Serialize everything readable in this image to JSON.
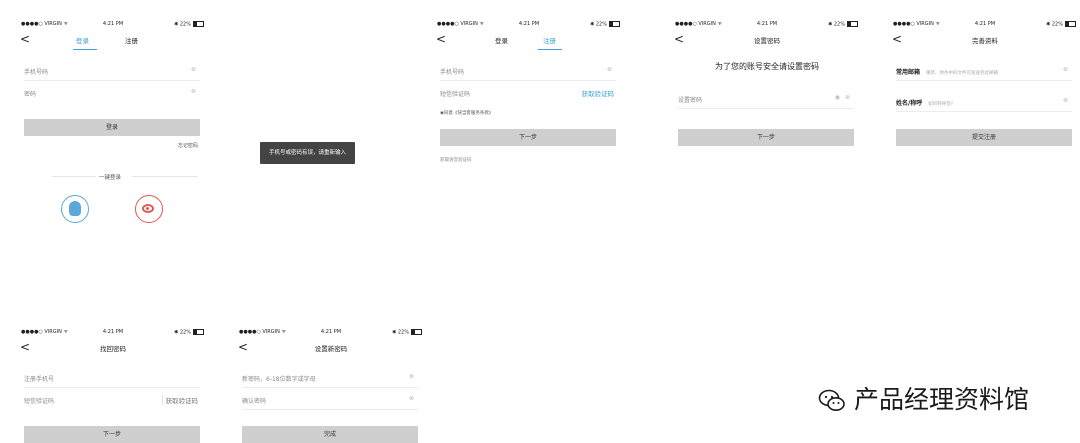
{
  "status_bar": {
    "carrier": "●●●●○ VIRGIN ᯤ",
    "time": "4:21 PM",
    "battery": "✱ 22%"
  },
  "login": {
    "tabs": [
      "登录",
      "注册"
    ],
    "phone_placeholder": "手机号码",
    "password_placeholder": "密码",
    "login_button": "登录",
    "forgot_password": "忘记密码",
    "one_click_login": "一键登录"
  },
  "toast": {
    "text": "手机号或密码有误，请重新输入"
  },
  "register": {
    "tabs": [
      "登录",
      "注册"
    ],
    "phone_placeholder": "手机号码",
    "sms_code_placeholder": "短信验证码",
    "get_code": "获取验证码",
    "agreement": "◉同意《快当客服务条款》",
    "next_button": "下一步",
    "no_code_hint": "获取语音验证码"
  },
  "set_password": {
    "title": "设置密码",
    "heading": "为了您的账号安全请设置密码",
    "password_placeholder": "设置密码",
    "next_button": "下一步"
  },
  "complete_profile": {
    "title": "完善资料",
    "email_label": "常用邮箱",
    "email_hint": "重新、财务中的文件可发送到此邮箱",
    "name_label": "姓名/称呼",
    "name_hint": "如何称呼您?",
    "submit_button": "提交注册"
  },
  "find_password": {
    "title": "找回密码",
    "phone_placeholder": "注册手机号",
    "sms_code_placeholder": "短信验证码",
    "get_code": "获取验证码",
    "next_button": "下一步"
  },
  "new_password": {
    "title": "设置新密码",
    "new_password_placeholder": "新密码，6-18位数字或字母",
    "confirm_placeholder": "确认密码",
    "done_button": "完成"
  },
  "watermark": {
    "text": "产品经理资料馆"
  }
}
